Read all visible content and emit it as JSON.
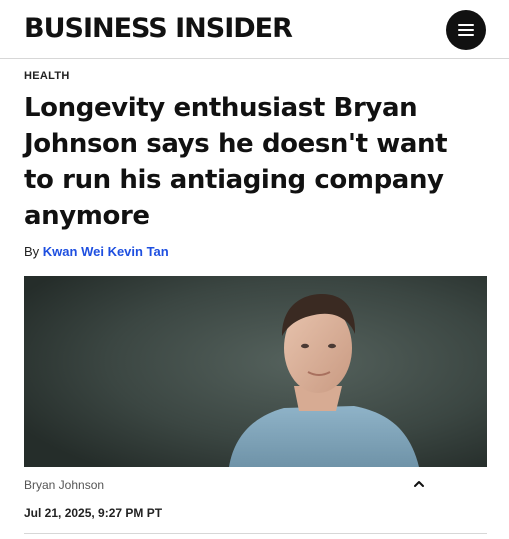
{
  "header": {
    "logo_text": "BUSINESS INSIDER",
    "menu_icon": "hamburger-menu-icon"
  },
  "article": {
    "section": "HEALTH",
    "headline": "Longevity enthusiast Bryan Johnson says he doesn't want to run his antiaging company anymore",
    "byline_prefix": "By",
    "author": "Kwan Wei Kevin Tan",
    "image_caption": "Bryan Johnson",
    "date": "Jul 21, 2025, 9:27 PM PT"
  },
  "colors": {
    "author_link": "#1e4fe0",
    "menu_button": "#111111"
  }
}
